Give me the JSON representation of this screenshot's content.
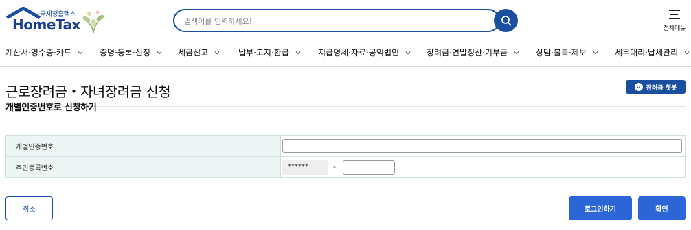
{
  "header": {
    "logo_kr": "국세청홈택스",
    "logo_en": "HomeTax",
    "search_placeholder": "검색어를 입력하세요!",
    "all_menu_label": "전체메뉴"
  },
  "nav": {
    "items": [
      {
        "label": "계산서·영수증·카드"
      },
      {
        "label": "증명·등록·신청"
      },
      {
        "label": "세금신고"
      },
      {
        "label": "납부·고지·환급"
      },
      {
        "label": "지급명세·자료·공익법인"
      },
      {
        "label": "장려금·연말정산·기부금"
      },
      {
        "label": "상담·불복·제보"
      },
      {
        "label": "세무대리·납세관리"
      }
    ]
  },
  "page": {
    "title": "근로장려금・자녀장려금 신청",
    "chatbot_label": "장려금 챗봇",
    "section_title": "개별인증번호로 신청하기"
  },
  "form": {
    "auth_label": "개별인증번호",
    "auth_value": "",
    "rrn_label": "주민등록번호",
    "rrn_masked": "******",
    "rrn_separator": "-",
    "rrn_back_value": ""
  },
  "buttons": {
    "cancel": "취소",
    "login": "로그인하기",
    "confirm": "확인"
  },
  "colors": {
    "brand": "#1a4fa0",
    "primary_button": "#2a66d6",
    "table_header_bg": "#eef6f5"
  }
}
